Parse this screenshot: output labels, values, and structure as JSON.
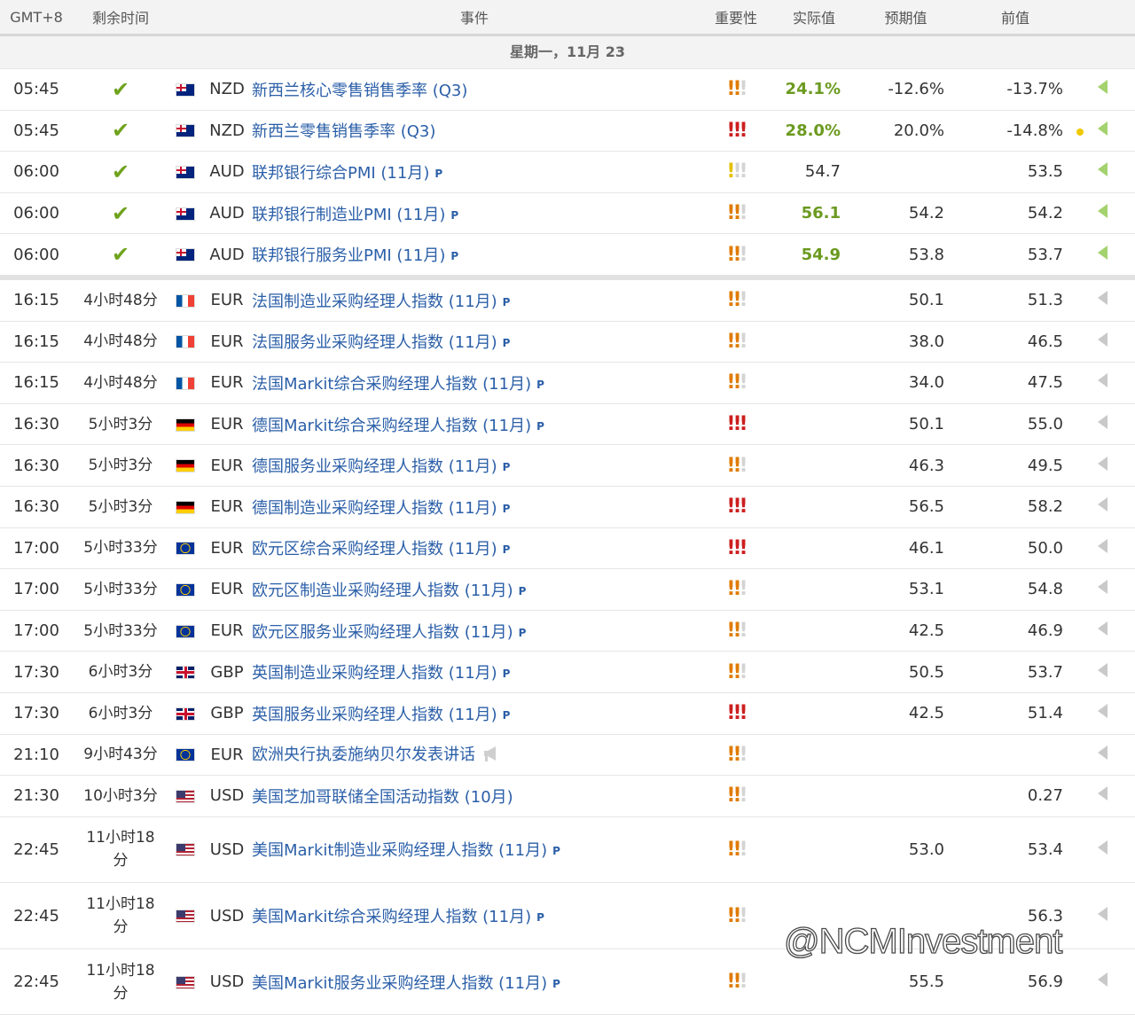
{
  "header": {
    "timezone": "GMT+8",
    "remaining": "剩余时间",
    "event": "事件",
    "importance": "重要性",
    "actual": "实际值",
    "forecast": "预期值",
    "previous": "前值"
  },
  "day_label": "星期一，11月 23",
  "colors": {
    "link_blue": "#2b5fa8",
    "good_green": "#6b9a1f",
    "high_red": "#cc1f1f",
    "mid_orange": "#e07b00"
  },
  "rows": [
    {
      "time": "05:45",
      "remaining": "",
      "done": true,
      "flag": "nzd",
      "currency": "NZD",
      "event": "新西兰核心零售销售季率 (Q3)",
      "p": false,
      "speech": false,
      "importance": 2,
      "actual": "24.1%",
      "actual_good": true,
      "forecast": "-12.6%",
      "previous": "-13.7%",
      "dot": false,
      "arrow": "g"
    },
    {
      "time": "05:45",
      "remaining": "",
      "done": true,
      "flag": "nzd",
      "currency": "NZD",
      "event": "新西兰零售销售季率 (Q3)",
      "p": false,
      "speech": false,
      "importance": 3,
      "actual": "28.0%",
      "actual_good": true,
      "forecast": "20.0%",
      "previous": "-14.8%",
      "dot": true,
      "arrow": "g"
    },
    {
      "time": "06:00",
      "remaining": "",
      "done": true,
      "flag": "aud",
      "currency": "AUD",
      "event": "联邦银行综合PMI (11月)",
      "p": true,
      "speech": false,
      "importance": 1,
      "actual": "54.7",
      "actual_good": false,
      "forecast": "",
      "previous": "53.5",
      "dot": false,
      "arrow": "g"
    },
    {
      "time": "06:00",
      "remaining": "",
      "done": true,
      "flag": "aud",
      "currency": "AUD",
      "event": "联邦银行制造业PMI (11月)",
      "p": true,
      "speech": false,
      "importance": 2,
      "actual": "56.1",
      "actual_good": true,
      "forecast": "54.2",
      "previous": "54.2",
      "dot": false,
      "arrow": "g"
    },
    {
      "time": "06:00",
      "remaining": "",
      "done": true,
      "flag": "aud",
      "currency": "AUD",
      "event": "联邦银行服务业PMI (11月)",
      "p": true,
      "speech": false,
      "importance": 2,
      "actual": "54.9",
      "actual_good": true,
      "forecast": "53.8",
      "previous": "53.7",
      "dot": false,
      "arrow": "g",
      "sep": true
    },
    {
      "time": "16:15",
      "remaining": "4小时48分",
      "done": false,
      "flag": "eur-fr",
      "currency": "EUR",
      "event": "法国制造业采购经理人指数 (11月)",
      "p": true,
      "speech": false,
      "importance": 2,
      "actual": "",
      "actual_good": false,
      "forecast": "50.1",
      "previous": "51.3",
      "dot": false,
      "arrow": "n"
    },
    {
      "time": "16:15",
      "remaining": "4小时48分",
      "done": false,
      "flag": "eur-fr",
      "currency": "EUR",
      "event": "法国服务业采购经理人指数 (11月)",
      "p": true,
      "speech": false,
      "importance": 2,
      "actual": "",
      "actual_good": false,
      "forecast": "38.0",
      "previous": "46.5",
      "dot": false,
      "arrow": "n"
    },
    {
      "time": "16:15",
      "remaining": "4小时48分",
      "done": false,
      "flag": "eur-fr",
      "currency": "EUR",
      "event": "法国Markit综合采购经理人指数 (11月)",
      "p": true,
      "speech": false,
      "importance": 2,
      "actual": "",
      "actual_good": false,
      "forecast": "34.0",
      "previous": "47.5",
      "dot": false,
      "arrow": "n"
    },
    {
      "time": "16:30",
      "remaining": "5小时3分",
      "done": false,
      "flag": "eur-de",
      "currency": "EUR",
      "event": "德国Markit综合采购经理人指数 (11月)",
      "p": true,
      "speech": false,
      "importance": 3,
      "actual": "",
      "actual_good": false,
      "forecast": "50.1",
      "previous": "55.0",
      "dot": false,
      "arrow": "n"
    },
    {
      "time": "16:30",
      "remaining": "5小时3分",
      "done": false,
      "flag": "eur-de",
      "currency": "EUR",
      "event": "德国服务业采购经理人指数 (11月)",
      "p": true,
      "speech": false,
      "importance": 2,
      "actual": "",
      "actual_good": false,
      "forecast": "46.3",
      "previous": "49.5",
      "dot": false,
      "arrow": "n"
    },
    {
      "time": "16:30",
      "remaining": "5小时3分",
      "done": false,
      "flag": "eur-de",
      "currency": "EUR",
      "event": "德国制造业采购经理人指数 (11月)",
      "p": true,
      "speech": false,
      "importance": 3,
      "actual": "",
      "actual_good": false,
      "forecast": "56.5",
      "previous": "58.2",
      "dot": false,
      "arrow": "n"
    },
    {
      "time": "17:00",
      "remaining": "5小时33分",
      "done": false,
      "flag": "eur-eu",
      "currency": "EUR",
      "event": "欧元区综合采购经理人指数 (11月)",
      "p": true,
      "speech": false,
      "importance": 3,
      "actual": "",
      "actual_good": false,
      "forecast": "46.1",
      "previous": "50.0",
      "dot": false,
      "arrow": "n"
    },
    {
      "time": "17:00",
      "remaining": "5小时33分",
      "done": false,
      "flag": "eur-eu",
      "currency": "EUR",
      "event": "欧元区制造业采购经理人指数 (11月)",
      "p": true,
      "speech": false,
      "importance": 2,
      "actual": "",
      "actual_good": false,
      "forecast": "53.1",
      "previous": "54.8",
      "dot": false,
      "arrow": "n"
    },
    {
      "time": "17:00",
      "remaining": "5小时33分",
      "done": false,
      "flag": "eur-eu",
      "currency": "EUR",
      "event": "欧元区服务业采购经理人指数 (11月)",
      "p": true,
      "speech": false,
      "importance": 2,
      "actual": "",
      "actual_good": false,
      "forecast": "42.5",
      "previous": "46.9",
      "dot": false,
      "arrow": "n"
    },
    {
      "time": "17:30",
      "remaining": "6小时3分",
      "done": false,
      "flag": "gbp",
      "currency": "GBP",
      "event": "英国制造业采购经理人指数 (11月)",
      "p": true,
      "speech": false,
      "importance": 2,
      "actual": "",
      "actual_good": false,
      "forecast": "50.5",
      "previous": "53.7",
      "dot": false,
      "arrow": "n"
    },
    {
      "time": "17:30",
      "remaining": "6小时3分",
      "done": false,
      "flag": "gbp",
      "currency": "GBP",
      "event": "英国服务业采购经理人指数 (11月)",
      "p": true,
      "speech": false,
      "importance": 3,
      "actual": "",
      "actual_good": false,
      "forecast": "42.5",
      "previous": "51.4",
      "dot": false,
      "arrow": "n"
    },
    {
      "time": "21:10",
      "remaining": "9小时43分",
      "done": false,
      "flag": "eur-eu",
      "currency": "EUR",
      "event": "欧洲央行执委施纳贝尔发表讲话",
      "p": false,
      "speech": true,
      "importance": 2,
      "actual": "",
      "actual_good": false,
      "forecast": "",
      "previous": "",
      "dot": false,
      "arrow": "n"
    },
    {
      "time": "21:30",
      "remaining": "10小时3分",
      "done": false,
      "flag": "usd",
      "currency": "USD",
      "event": "美国芝加哥联储全国活动指数 (10月)",
      "p": false,
      "speech": false,
      "importance": 2,
      "actual": "",
      "actual_good": false,
      "forecast": "",
      "previous": "0.27",
      "dot": false,
      "arrow": "n"
    },
    {
      "time": "22:45",
      "remaining": "11小时18分",
      "done": false,
      "flag": "usd",
      "currency": "USD",
      "event": "美国Markit制造业采购经理人指数 (11月)",
      "p": true,
      "speech": false,
      "importance": 2,
      "actual": "",
      "actual_good": false,
      "forecast": "53.0",
      "previous": "53.4",
      "dot": false,
      "arrow": "n",
      "tall": true
    },
    {
      "time": "22:45",
      "remaining": "11小时18分",
      "done": false,
      "flag": "usd",
      "currency": "USD",
      "event": "美国Markit综合采购经理人指数 (11月)",
      "p": true,
      "speech": false,
      "importance": 2,
      "actual": "",
      "actual_good": false,
      "forecast": "",
      "previous": "56.3",
      "dot": false,
      "arrow": "n",
      "tall": true
    },
    {
      "time": "22:45",
      "remaining": "11小时18分",
      "done": false,
      "flag": "usd",
      "currency": "USD",
      "event": "美国Markit服务业采购经理人指数 (11月)",
      "p": true,
      "speech": false,
      "importance": 2,
      "actual": "",
      "actual_good": false,
      "forecast": "55.5",
      "previous": "56.9",
      "dot": false,
      "arrow": "n",
      "tall": true
    }
  ],
  "p_mark": "P",
  "watermark": "@NCMInvestment"
}
